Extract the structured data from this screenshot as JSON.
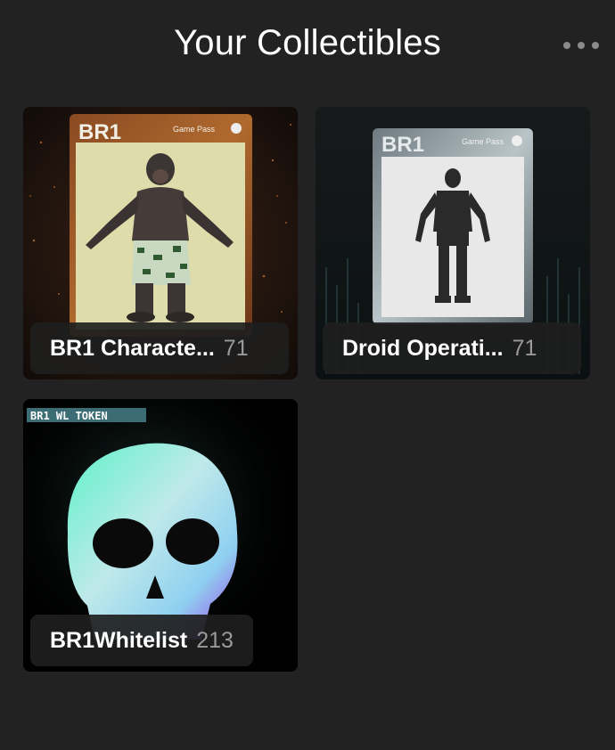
{
  "header": {
    "title": "Your Collectibles",
    "more_icon": "more-horizontal-icon"
  },
  "collections": [
    {
      "name": "BR1 Characte...",
      "count": "71",
      "card_brand": "BR1",
      "card_tag": "Game Pass",
      "art": "chimp-character-card"
    },
    {
      "name": "Droid Operati...",
      "count": "71",
      "card_brand": "BR1",
      "card_tag": "Game Pass",
      "art": "droid-silhouette-card"
    },
    {
      "name": "BR1Whitelist",
      "count": "213",
      "card_brand": "BR1 WL TOKEN",
      "art": "glowing-skull"
    }
  ],
  "colors": {
    "background": "#222222",
    "pill": "#1e1e1e",
    "count_text": "#9a9a9a"
  }
}
